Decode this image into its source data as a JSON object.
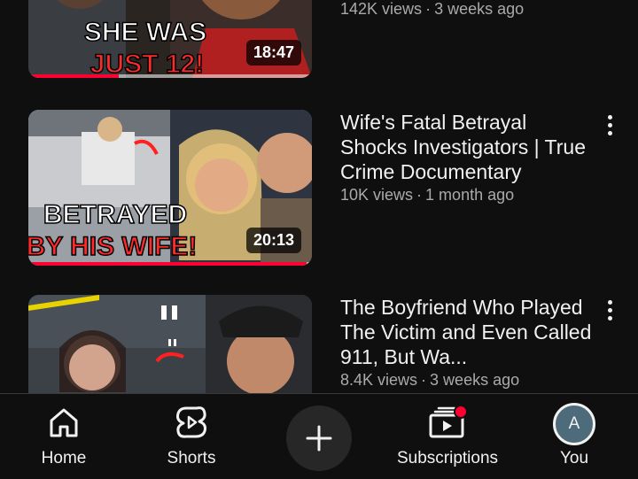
{
  "feed": {
    "videos": [
      {
        "thumbnail_text": [
          "SHE WAS",
          "JUST 12!"
        ],
        "duration": "18:47",
        "watched_fraction": 0.32,
        "title": "",
        "views": "142K views",
        "age": "3 weeks ago"
      },
      {
        "thumbnail_text": [
          "BETRAYED",
          "BY HIS WIFE!"
        ],
        "duration": "20:13",
        "watched_fraction": 0.98,
        "title": "Wife's Fatal Betrayal Shocks Investigators | True Crime Documentary",
        "views": "10K views",
        "age": "1 month ago"
      },
      {
        "thumbnail_text": [],
        "duration": "",
        "watched_fraction": 0,
        "title": "The Boyfriend Who Played The Victim and Even Called 911, But Wa...",
        "views": "8.4K views",
        "age": "3 weeks ago"
      }
    ],
    "separator": "·",
    "more_icon": "more-vertical-icon"
  },
  "bottom_nav": {
    "home": {
      "label": "Home",
      "icon": "home-icon"
    },
    "shorts": {
      "label": "Shorts",
      "icon": "shorts-icon"
    },
    "create": {
      "icon": "plus-icon"
    },
    "subscriptions": {
      "label": "Subscriptions",
      "icon": "subscriptions-icon",
      "badge_color": "#ff0033"
    },
    "you": {
      "label": "You",
      "avatar_letter": "A",
      "avatar_color": "#4d6b7b"
    }
  },
  "colors": {
    "background": "#0f0f0f",
    "accent": "#ff0033",
    "secondary_text": "#aaaaaa"
  }
}
